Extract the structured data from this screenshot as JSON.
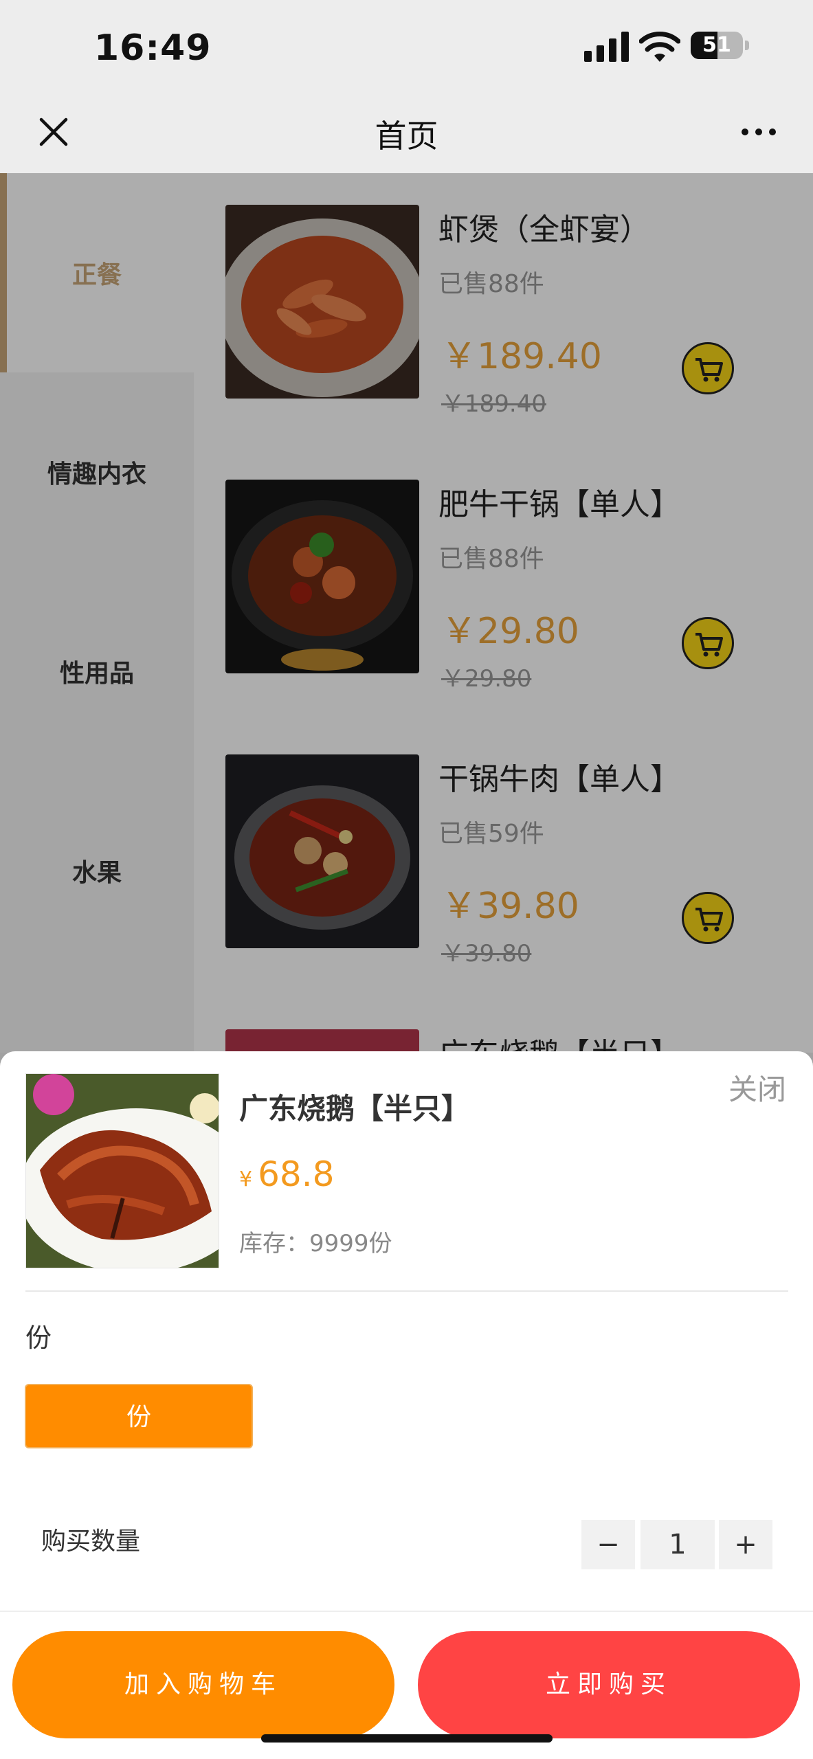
{
  "status_bar": {
    "time": "16:49",
    "battery": "51",
    "battery_level": 0.51
  },
  "navbar": {
    "title": "首页"
  },
  "sidebar": {
    "categories": [
      {
        "label": "正餐",
        "active": true
      },
      {
        "label": "情趣内衣",
        "active": false
      },
      {
        "label": "性用品",
        "active": false
      },
      {
        "label": "水果",
        "active": false
      }
    ]
  },
  "products": [
    {
      "name": "虾煲（全虾宴）",
      "sold": "已售88件",
      "price": "￥189.40",
      "original_price": "￥189.40",
      "image": "shrimp-pot-photo"
    },
    {
      "name": "肥牛干锅【单人】",
      "sold": "已售88件",
      "price": "￥29.80",
      "original_price": "￥29.80",
      "image": "beef-dry-pot-photo"
    },
    {
      "name": "干锅牛肉【单人】",
      "sold": "已售59件",
      "price": "￥39.80",
      "original_price": "￥39.80",
      "image": "dry-pot-beef-photo"
    },
    {
      "name": "广东烧鹅【半只】",
      "image": "roast-goose-photo"
    }
  ],
  "sheet": {
    "name": "广东烧鹅【半只】",
    "close": "关闭",
    "currency": "¥",
    "price": "68.8",
    "stock": "库存：9999份",
    "spec_label": "份",
    "spec_option": "份",
    "qty_label": "购买数量",
    "qty_minus": "−",
    "qty_value": "1",
    "qty_plus": "+",
    "add_to_cart": "加入购物车",
    "buy_now": "立即购买"
  },
  "colors": {
    "accent_gold": "#c8a578",
    "price_orange": "#e8a33c",
    "primary_orange": "#ff8c00",
    "buy_red": "#ff4444",
    "cart_yellow": "#f7d417"
  }
}
